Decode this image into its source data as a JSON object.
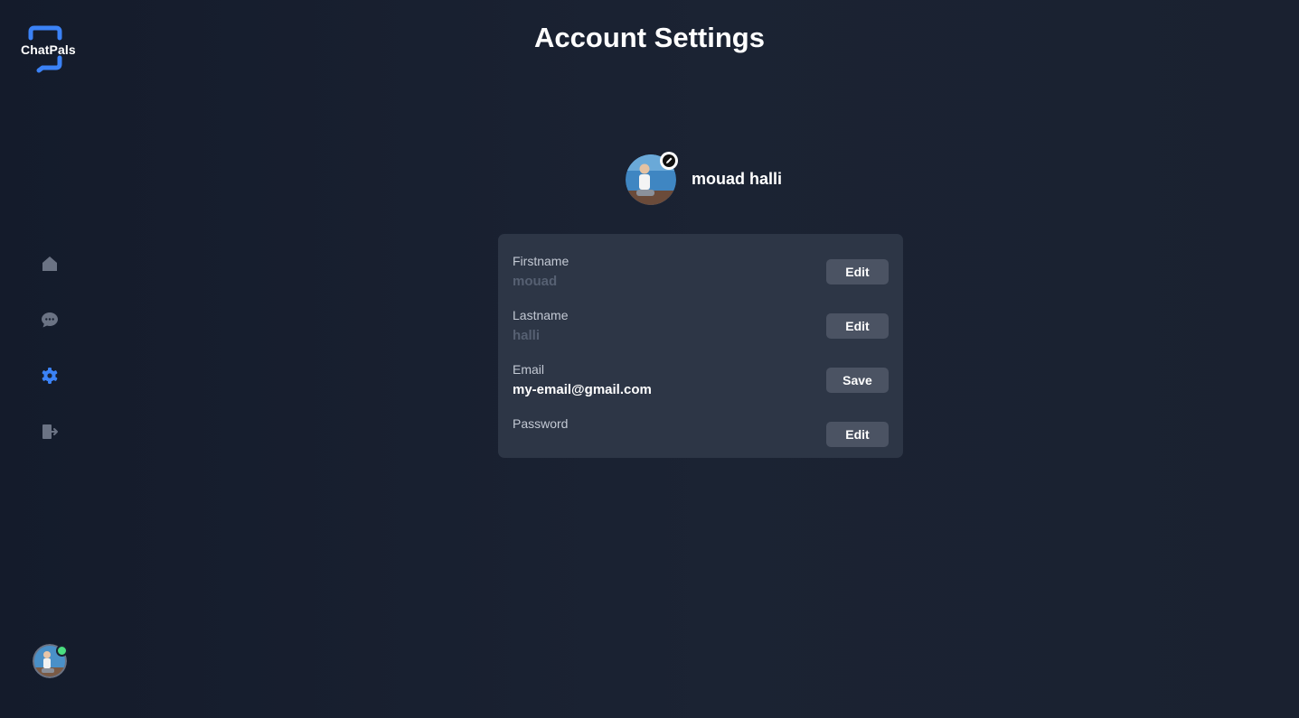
{
  "app": {
    "logo_text": "ChatPals"
  },
  "sidebar": {
    "items": [
      {
        "name": "home",
        "icon": "home-icon"
      },
      {
        "name": "chat",
        "icon": "chat-icon"
      },
      {
        "name": "settings",
        "icon": "gear-icon",
        "active": true
      },
      {
        "name": "logout",
        "icon": "logout-icon"
      }
    ],
    "user_status": "online"
  },
  "page": {
    "title": "Account Settings"
  },
  "profile": {
    "name": "mouad halli"
  },
  "fields": [
    {
      "label": "Firstname",
      "value": "mouad",
      "button": "Edit"
    },
    {
      "label": "Lastname",
      "value": "halli",
      "button": "Edit"
    },
    {
      "label": "Email",
      "value": "my-email@gmail.com",
      "button": "Save"
    },
    {
      "label": "Password",
      "value": "",
      "button": "Edit"
    }
  ],
  "colors": {
    "accent": "#3b82f6",
    "background": "#1b2333",
    "card": "#2d3646",
    "button": "#4b5363",
    "online": "#4ade80"
  }
}
